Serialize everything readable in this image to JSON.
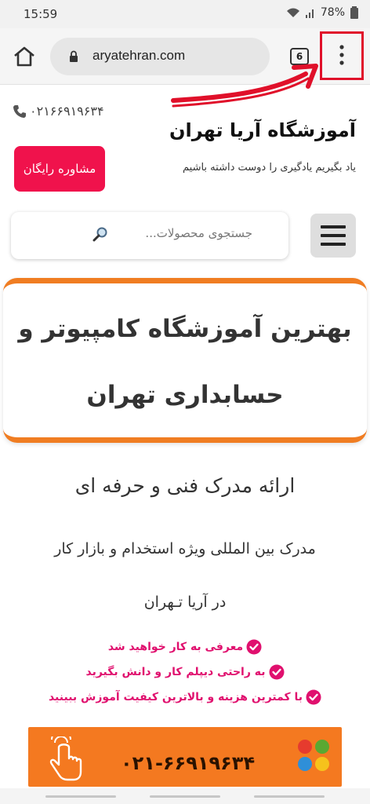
{
  "status_bar": {
    "time": "15:59",
    "battery": "78%"
  },
  "browser": {
    "url": "aryatehran.com",
    "tab_count": "6"
  },
  "header": {
    "phone": "۰۲۱۶۶۹۱۹۶۳۴",
    "title": "آموزشگاه آریا تهران",
    "subtitle": "یاد بگیریم یادگیری را دوست داشته باشیم",
    "consult_button": "مشاوره رایگان"
  },
  "search": {
    "placeholder": "جستجوی محصولات..."
  },
  "hero": {
    "line1": "بهترین آموزشگاه کامپیوتر و",
    "line2": "حسابداری تهران"
  },
  "body": {
    "line_a": "ارائه مدرک فنی و حرفه ای",
    "line_b": "مدرک بین المللی ویژه استخدام و بازار کار",
    "line_c": "در آریا تـهران"
  },
  "checks": [
    {
      "text": "معرفی به کار خواهید شد"
    },
    {
      "text": "به راحتی دیپلم کار و دانش بگیرید"
    },
    {
      "text": "با کمترین هزینه و بالاترین کیفیت آموزش ببینید"
    }
  ],
  "cta": {
    "phone": "۰۲۱-۶۶۹۱۹۶۳۴"
  },
  "colors": {
    "accent_orange": "#f07d22",
    "button_pink": "#f0124c",
    "check_pink": "#e0106e",
    "annotation_red": "#e0102a"
  },
  "icons": [
    "home-icon",
    "lock-icon",
    "kebab-icon",
    "phone-icon",
    "search-icon",
    "hamburger-icon",
    "check-icon",
    "hand-icon",
    "dots-icon"
  ]
}
